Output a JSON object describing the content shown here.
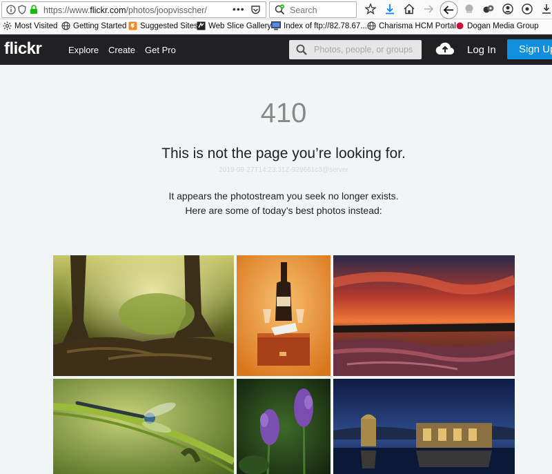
{
  "browser": {
    "url_prefix": "https://www.",
    "url_domain": "flickr.com",
    "url_path": "/photos/joopvisscher/",
    "url_more": "•••",
    "search_placeholder": "Search"
  },
  "bookmarks": [
    {
      "label": "Most Visited",
      "icon": "gear-icon"
    },
    {
      "label": "Getting Started",
      "icon": "globe-icon"
    },
    {
      "label": "Suggested Sites",
      "icon": "suggested-sites-icon"
    },
    {
      "label": "Web Slice Gallery",
      "icon": "web-slice-icon"
    },
    {
      "label": "Index of ftp://82.78.67....",
      "icon": "monitor-icon"
    },
    {
      "label": "Charisma HCM Portal",
      "icon": "globe-icon"
    },
    {
      "label": "Dogan Media Group",
      "icon": "red-dot-icon"
    }
  ],
  "header": {
    "logo": "flickr",
    "nav": [
      "Explore",
      "Create",
      "Get Pro"
    ],
    "search_placeholder": "Photos, people, or groups",
    "login": "Log In",
    "signup": "Sign Up"
  },
  "error": {
    "code": "410",
    "headline": "This is not the page you’re looking for.",
    "timestamp": "2019-09-27T14:23:31Z-929661c3@server",
    "message_line1": "It appears the photostream you seek no longer exists.",
    "message_line2": "Here are some of today’s best photos instead:"
  },
  "photos": [
    {
      "name": "photo-forest-roots",
      "colors": [
        "#5c5b22",
        "#a8b24a",
        "#2e2410"
      ]
    },
    {
      "name": "photo-bottle-still-life",
      "colors": [
        "#e08a22",
        "#f2a94a",
        "#3a2412"
      ]
    },
    {
      "name": "photo-red-sunset-river",
      "colors": [
        "#2c2a48",
        "#d8502c",
        "#5a2c34"
      ]
    },
    {
      "name": "photo-dragonfly",
      "colors": [
        "#6e8a2c",
        "#b6c664",
        "#2f3a16"
      ]
    },
    {
      "name": "photo-lavender",
      "colors": [
        "#1e3418",
        "#7e56b4",
        "#3c5a28"
      ]
    },
    {
      "name": "photo-night-ruins",
      "colors": [
        "#0e1a44",
        "#2c4c8a",
        "#c8a24a"
      ]
    }
  ]
}
